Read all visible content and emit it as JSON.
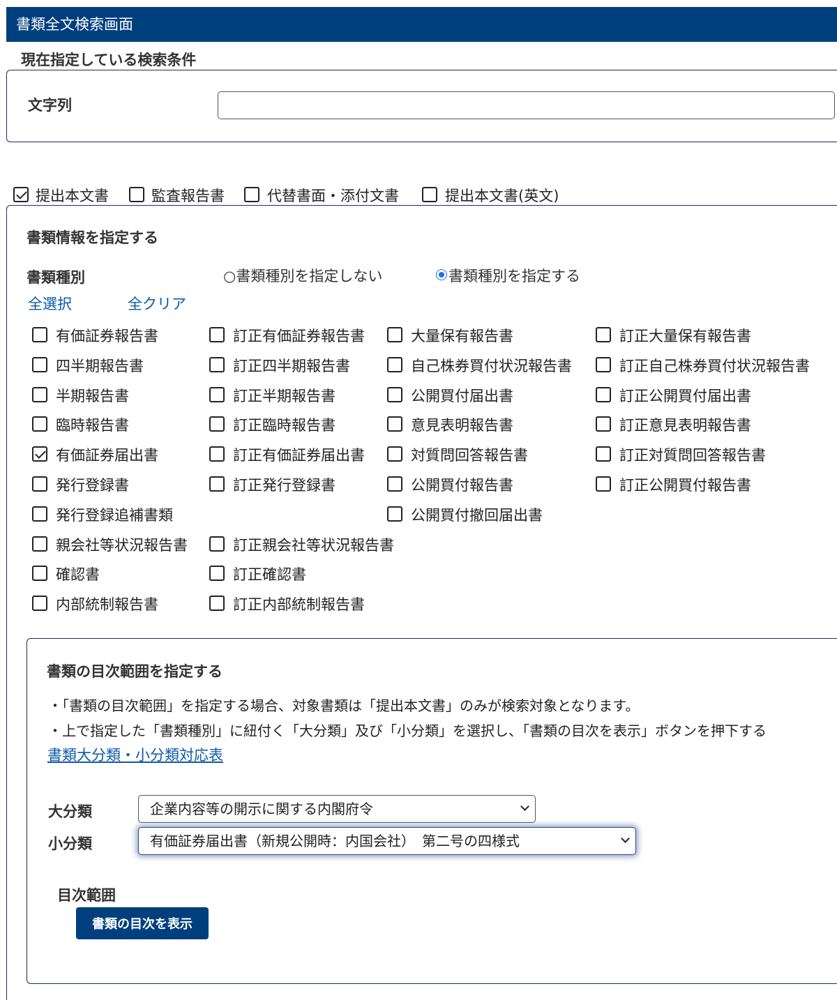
{
  "header": {
    "title": "書類全文検索画面"
  },
  "conditions": {
    "section_title": "現在指定している検索条件",
    "string_label": "文字列",
    "string_value": "",
    "string_placeholder": ""
  },
  "doc_sources": [
    {
      "label": "提出本文書",
      "checked": true
    },
    {
      "label": "監査報告書",
      "checked": false
    },
    {
      "label": "代替書面・添付文書",
      "checked": false
    },
    {
      "label": "提出本文書(英文)",
      "checked": false
    }
  ],
  "doc_info": {
    "title": "書類情報を指定する",
    "type_label": "書類種別",
    "radio_unspecified": "○書類種別を指定しない",
    "radio_specified": "書類種別を指定する",
    "radio_selected": "specified",
    "select_all": "全選択",
    "clear_all": "全クリア",
    "doc_types": {
      "col1": [
        {
          "label": "有価証券報告書",
          "checked": false
        },
        {
          "label": "四半期報告書",
          "checked": false
        },
        {
          "label": "半期報告書",
          "checked": false
        },
        {
          "label": "臨時報告書",
          "checked": false
        },
        {
          "label": "有価証券届出書",
          "checked": true
        },
        {
          "label": "発行登録書",
          "checked": false
        },
        {
          "label": "発行登録追補書類",
          "checked": false
        },
        {
          "label": "親会社等状況報告書",
          "checked": false
        },
        {
          "label": "確認書",
          "checked": false
        },
        {
          "label": "内部統制報告書",
          "checked": false
        }
      ],
      "col2": [
        {
          "label": "訂正有価証券報告書",
          "checked": false
        },
        {
          "label": "訂正四半期報告書",
          "checked": false
        },
        {
          "label": "訂正半期報告書",
          "checked": false
        },
        {
          "label": "訂正臨時報告書",
          "checked": false
        },
        {
          "label": "訂正有価証券届出書",
          "checked": false
        },
        {
          "label": "訂正発行登録書",
          "checked": false
        },
        null,
        {
          "label": "訂正親会社等状況報告書",
          "checked": false
        },
        {
          "label": "訂正確認書",
          "checked": false
        },
        {
          "label": "訂正内部統制報告書",
          "checked": false
        }
      ],
      "col3": [
        {
          "label": "大量保有報告書",
          "checked": false
        },
        {
          "label": "自己株券買付状況報告書",
          "checked": false
        },
        {
          "label": "公開買付届出書",
          "checked": false
        },
        {
          "label": "意見表明報告書",
          "checked": false
        },
        {
          "label": "対質問回答報告書",
          "checked": false
        },
        {
          "label": "公開買付報告書",
          "checked": false
        },
        {
          "label": "公開買付撤回届出書",
          "checked": false
        }
      ],
      "col4": [
        {
          "label": "訂正大量保有報告書",
          "checked": false
        },
        {
          "label": "訂正自己株券買付状況報告書",
          "checked": false
        },
        {
          "label": "訂正公開買付届出書",
          "checked": false
        },
        {
          "label": "訂正意見表明報告書",
          "checked": false
        },
        {
          "label": "訂正対質問回答報告書",
          "checked": false
        },
        {
          "label": "訂正公開買付報告書",
          "checked": false
        }
      ]
    }
  },
  "toc": {
    "title": "書類の目次範囲を指定する",
    "note1": "・「書類の目次範囲」を指定する場合、対象書類は「提出本文書」のみが検索対象となります。",
    "note2": "・上で指定した「書類種別」に紐付く「大分類」及び「小分類」を選択し、「書類の目次を表示」ボタンを押下する",
    "table_link": "書類大分類・小分類対応表",
    "major_label": "大分類",
    "major_value": "企業内容等の開示に関する内閣府令",
    "minor_label": "小分類",
    "minor_value": "有価証券届出書（新規公開時：内国会社）　第二号の四様式",
    "range_label": "目次範囲",
    "show_button": "書類の目次を表示"
  }
}
